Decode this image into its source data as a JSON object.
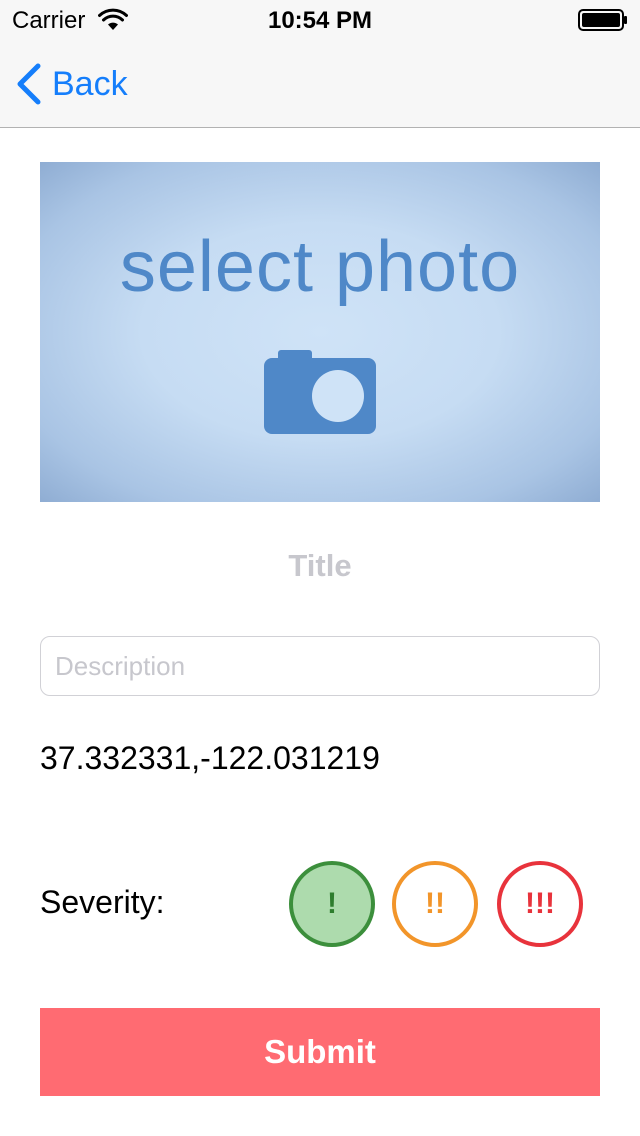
{
  "status_bar": {
    "carrier": "Carrier",
    "time": "10:54 PM"
  },
  "nav": {
    "back_label": "Back"
  },
  "photo_picker": {
    "label": "select photo",
    "icon": "camera-icon"
  },
  "form": {
    "title_placeholder": "Title",
    "description_placeholder": "Description",
    "coordinates": "37.332331,-122.031219",
    "severity_label": "Severity:",
    "severity_options": [
      {
        "label": "!",
        "color": "#3c8f3c",
        "selected": true
      },
      {
        "label": "!!",
        "color": "#f2952a",
        "selected": false
      },
      {
        "label": "!!!",
        "color": "#e8333c",
        "selected": false
      }
    ],
    "submit_label": "Submit"
  },
  "colors": {
    "accent": "#157efb",
    "submit": "#ff6b72"
  }
}
